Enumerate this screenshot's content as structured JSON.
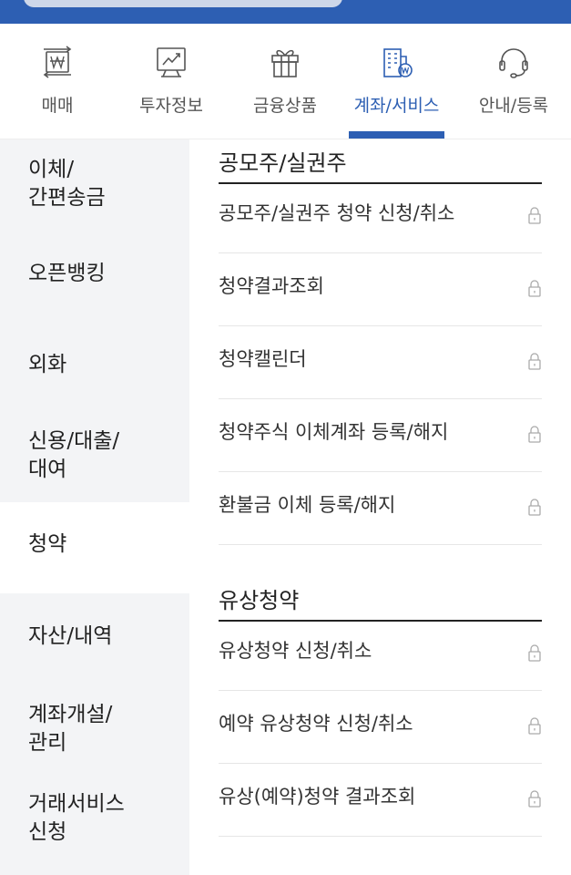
{
  "nav": {
    "items": [
      {
        "label": "매매",
        "icon": "won-exchange-icon"
      },
      {
        "label": "투자정보",
        "icon": "chart-monitor-icon"
      },
      {
        "label": "금융상품",
        "icon": "gift-box-icon"
      },
      {
        "label": "계좌/서비스",
        "icon": "building-won-icon"
      },
      {
        "label": "안내/등록",
        "icon": "headset-icon"
      }
    ],
    "active_index": 3,
    "accent": "#2d5fb3"
  },
  "sidebar": {
    "items": [
      {
        "line1": "이체/",
        "line2": "간편송금"
      },
      {
        "line1": "오픈뱅킹",
        "line2": ""
      },
      {
        "line1": "외화",
        "line2": ""
      },
      {
        "line1": "신용/대출/",
        "line2": "대여"
      },
      {
        "line1": "청약",
        "line2": ""
      },
      {
        "line1": "자산/내역",
        "line2": ""
      },
      {
        "line1": "계좌개설/",
        "line2": "관리"
      },
      {
        "line1": "거래서비스",
        "line2": "신청"
      }
    ],
    "active_index": 4
  },
  "sections": [
    {
      "title": "공모주/실권주",
      "items": [
        {
          "label": "공모주/실권주 청약 신청/취소",
          "icon": "lock-icon"
        },
        {
          "label": "청약결과조회",
          "icon": "lock-icon"
        },
        {
          "label": "청약캘린더",
          "icon": "lock-icon"
        },
        {
          "label": "청약주식 이체계좌 등록/해지",
          "icon": "lock-icon"
        },
        {
          "label": "환불금 이체 등록/해지",
          "icon": "lock-icon"
        }
      ]
    },
    {
      "title": "유상청약",
      "items": [
        {
          "label": "유상청약 신청/취소",
          "icon": "lock-icon"
        },
        {
          "label": "예약 유상청약 신청/취소",
          "icon": "lock-icon"
        },
        {
          "label": "유상(예약)청약 결과조회",
          "icon": "lock-icon"
        }
      ]
    }
  ]
}
